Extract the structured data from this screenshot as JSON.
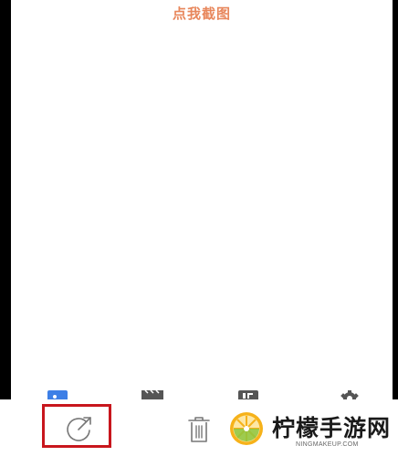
{
  "screen": {
    "capture_label": "点我截图"
  },
  "tabbar": {
    "tabs": [
      {
        "icon": "photo-icon",
        "color": "#3d7fe6"
      },
      {
        "icon": "video-clapper-icon",
        "color": "#555555"
      },
      {
        "icon": "gif-icon",
        "color": "#555555"
      },
      {
        "icon": "gear-icon",
        "color": "#555555"
      }
    ]
  },
  "actions": {
    "share_icon": "share-icon",
    "delete_icon": "trash-icon",
    "highlight_color": "#c8161d"
  },
  "watermark": {
    "title": "柠檬手游网",
    "subtitle": "NINGMAKEUP.COM"
  },
  "colors": {
    "accent": "#e8875c",
    "active_tab": "#3d7fe6"
  }
}
